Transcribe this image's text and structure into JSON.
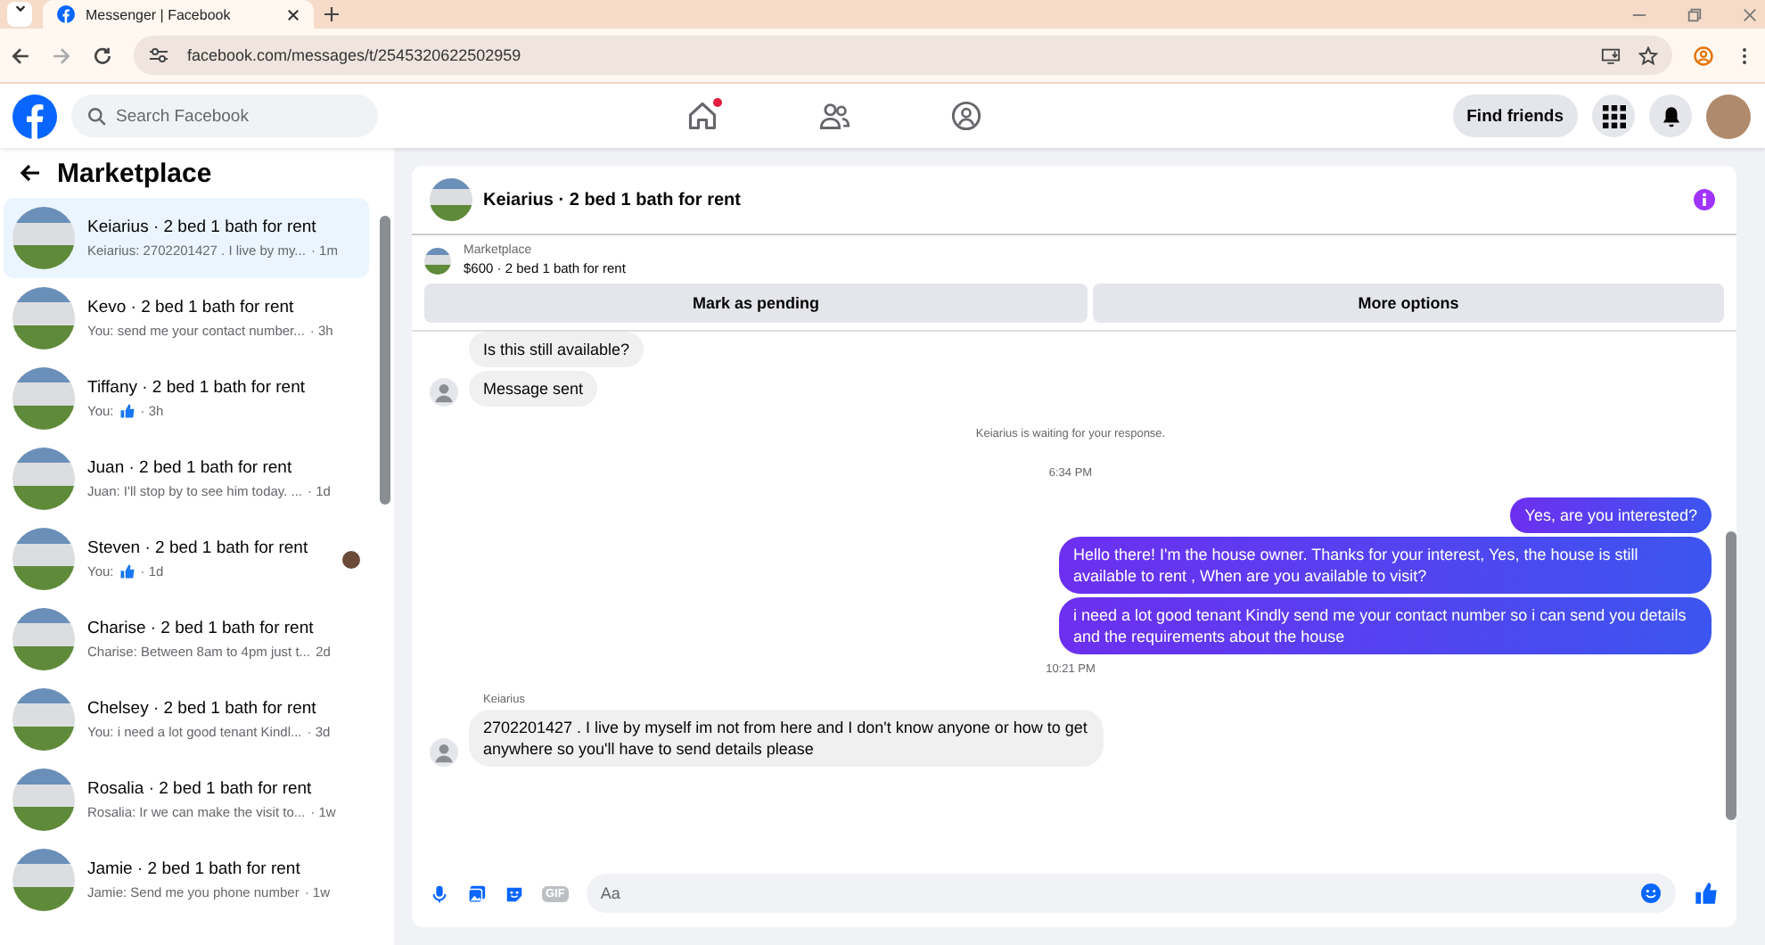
{
  "browser": {
    "tabs": [
      {
        "title": "Messenger | Facebook",
        "selected": true
      }
    ],
    "address": "facebook.com/messages/t/2545320622502959"
  },
  "header": {
    "search": {
      "placeholder": "Search Facebook"
    },
    "nav": [
      {
        "kind": "home",
        "badge": true
      },
      {
        "kind": "friends",
        "badge": false
      },
      {
        "kind": "groups",
        "badge": false
      }
    ],
    "find_friends": "Find friends"
  },
  "sidebar": {
    "title": "Marketplace",
    "conversations": [
      {
        "name": "Keiarius · 2 bed 1 bath for rent",
        "preview": "Keiarius: 2702201427 . I live by my...",
        "time": "· 1m",
        "liked": false,
        "seen": false,
        "selected": true
      },
      {
        "name": "Kevo · 2 bed 1 bath for rent",
        "preview": "You: send me your contact number...",
        "time": "· 3h",
        "liked": false,
        "seen": false,
        "selected": false
      },
      {
        "name": "Tiffany · 2 bed 1 bath for rent",
        "preview": "You:",
        "time": "· 3h",
        "liked": true,
        "seen": false,
        "selected": false
      },
      {
        "name": "Juan · 2 bed 1 bath for rent",
        "preview": "Juan: I'll stop by to see him today. ...",
        "time": "· 1d",
        "liked": false,
        "seen": false,
        "selected": false
      },
      {
        "name": "Steven · 2 bed 1 bath for rent",
        "preview": "You:",
        "time": "· 1d",
        "liked": true,
        "seen": true,
        "selected": false
      },
      {
        "name": "Charise · 2 bed 1 bath for rent",
        "preview": "Charise: Between 8am to 4pm just t...",
        "time": "2d",
        "liked": false,
        "seen": false,
        "selected": false
      },
      {
        "name": "Chelsey · 2 bed 1 bath for rent",
        "preview": "You: i need a lot good tenant Kindl...",
        "time": "· 3d",
        "liked": false,
        "seen": false,
        "selected": false
      },
      {
        "name": "Rosalia · 2 bed 1 bath for rent",
        "preview": "Rosalia: Ir we can make the visit to...",
        "time": "· 1w",
        "liked": false,
        "seen": false,
        "selected": false
      },
      {
        "name": "Jamie · 2 bed 1 bath for rent",
        "preview": "Jamie: Send me you phone number",
        "time": "· 1w",
        "liked": false,
        "seen": false,
        "selected": false
      }
    ]
  },
  "chat": {
    "title": "Keiarius · 2 bed 1 bath for rent",
    "listing": {
      "source": "Marketplace",
      "summary": "$600 · 2 bed 1 bath for rent"
    },
    "actions": [
      "Mark as pending",
      "More options"
    ],
    "messages": [
      {
        "kind": "incoming",
        "text": "Is this still available?",
        "avatar": false
      },
      {
        "kind": "incoming",
        "text": "Message sent",
        "avatar": true
      },
      {
        "kind": "notice",
        "text": "Keiarius is waiting for your response."
      },
      {
        "kind": "time",
        "text": "6:34 PM"
      },
      {
        "kind": "outgoing",
        "text": "Yes, are you interested?"
      },
      {
        "kind": "outgoing",
        "text": "Hello there! I'm the house owner. Thanks for your interest, Yes, the house is still available to rent , When are you available to visit?"
      },
      {
        "kind": "outgoing",
        "text": "i need a lot good tenant Kindly send me your contact number so i can send you details and the requirements about the house"
      },
      {
        "kind": "time",
        "text": "10:21 PM"
      },
      {
        "kind": "sender",
        "text": "Keiarius"
      },
      {
        "kind": "incoming",
        "text": "2702201427 . I live by myself im not from here and I don't know anyone or how to get anywhere so you'll have to send details please",
        "avatar": true
      }
    ],
    "composer": {
      "gif": "GIF",
      "placeholder": "Aa"
    }
  }
}
